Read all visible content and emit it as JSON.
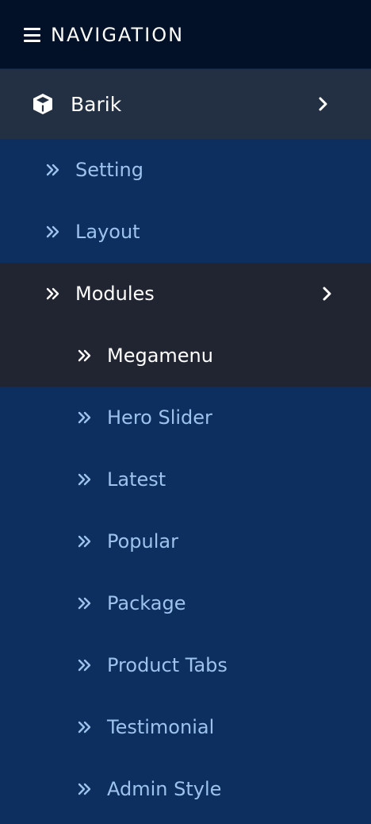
{
  "header": {
    "title": "NAVIGATION",
    "icon": "hamburger-menu-icon"
  },
  "root": {
    "label": "Barik",
    "icon": "cube-icon",
    "expand_icon": "chevron-right-icon"
  },
  "items": [
    {
      "label": "Setting"
    },
    {
      "label": "Layout"
    },
    {
      "label": "Modules"
    }
  ],
  "modules": [
    {
      "label": "Megamenu"
    },
    {
      "label": "Hero Slider"
    },
    {
      "label": "Latest"
    },
    {
      "label": "Popular"
    },
    {
      "label": "Package"
    },
    {
      "label": "Product Tabs"
    },
    {
      "label": "Testimonial"
    },
    {
      "label": "Admin Style"
    }
  ],
  "colors": {
    "header_bg": "#021128",
    "root_bg": "#233043",
    "menu_bg": "#0d2f60",
    "active_bg": "#212431",
    "item_text": "#9dc3ec",
    "active_text": "#ffffff"
  }
}
